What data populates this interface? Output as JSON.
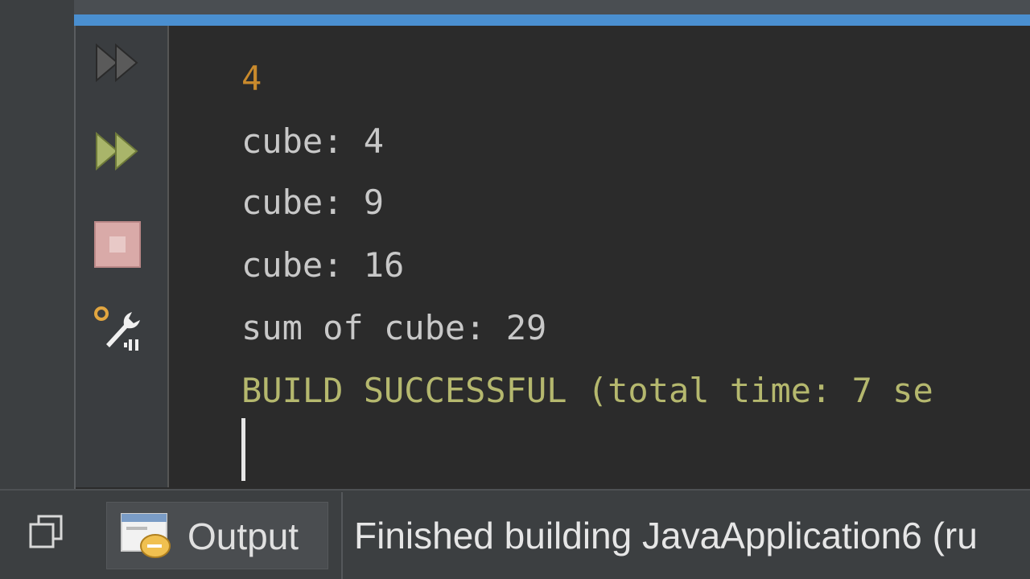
{
  "console": {
    "lines": [
      "4",
      "cube: 4",
      "cube: 9",
      "cube: 16",
      "sum of cube: 29",
      "BUILD SUCCESSFUL (total time: 7 se"
    ]
  },
  "toolbar": {
    "rerun_icon": "rerun-icon",
    "rerun_enabled_icon": "rerun-with-params-icon",
    "stop_icon": "stop-icon",
    "settings_icon": "wrench-settings-icon"
  },
  "bottom": {
    "output_tab_label": "Output",
    "status_text": "Finished building JavaApplication6 (ru"
  },
  "colors": {
    "console_bg": "#2b2b2b",
    "number_color": "#c98a2c",
    "build_color": "#b5b86e",
    "accent_stripe": "#4a8fd0"
  }
}
